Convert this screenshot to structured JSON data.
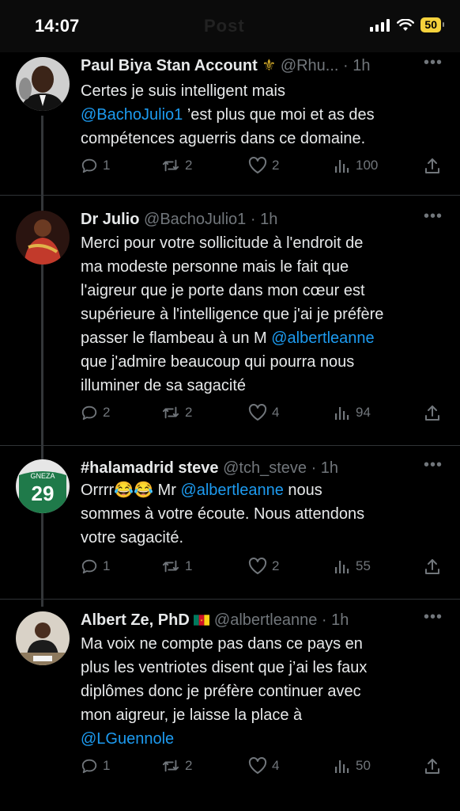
{
  "status": {
    "time": "14:07",
    "ghost_title": "Post",
    "battery": "50"
  },
  "tweets": [
    {
      "name": "Paul Biya Stan Account",
      "badge": "⚜",
      "handle": "@Rhu...",
      "time": "1h",
      "lines": [
        [
          {
            "t": "Certes je suis intelligent mais"
          }
        ],
        [
          {
            "t": "@BachoJulio1",
            "m": true
          },
          {
            "t": " ’est plus que moi et as des"
          }
        ],
        [
          {
            "t": "compétences aguerris dans ce domaine."
          }
        ]
      ],
      "replies": "1",
      "reposts": "2",
      "likes": "2",
      "views": "100"
    },
    {
      "name": "Dr Julio",
      "handle": "@BachoJulio1",
      "time": "1h",
      "lines": [
        [
          {
            "t": "Merci pour votre sollicitude à l'endroit de"
          }
        ],
        [
          {
            "t": "ma modeste personne mais le fait que"
          }
        ],
        [
          {
            "t": "l'aigreur que je porte dans mon cœur est"
          }
        ],
        [
          {
            "t": "supérieure à l'intelligence que j'ai je préfère"
          }
        ],
        [
          {
            "t": "passer le flambeau à un M "
          },
          {
            "t": "@albertleanne",
            "m": true
          }
        ],
        [
          {
            "t": "que j'admire beaucoup qui pourra nous"
          }
        ],
        [
          {
            "t": "illuminer de sa sagacité"
          }
        ]
      ],
      "replies": "2",
      "reposts": "2",
      "likes": "4",
      "views": "94"
    },
    {
      "name": "#halamadrid steve",
      "handle": "@tch_steve",
      "time": "1h",
      "lines": [
        [
          {
            "t": "Orrrr😂😂 Mr "
          },
          {
            "t": "@albertleanne",
            "m": true
          },
          {
            "t": "  nous"
          }
        ],
        [
          {
            "t": "sommes à votre écoute. Nous attendons"
          }
        ],
        [
          {
            "t": "votre sagacité."
          }
        ]
      ],
      "replies": "1",
      "reposts": "1",
      "likes": "2",
      "views": "55"
    },
    {
      "name": "Albert Ze, PhD",
      "handle": "@albertleanne",
      "time": "1h",
      "lines": [
        [
          {
            "t": "Ma voix ne compte pas dans ce pays en"
          }
        ],
        [
          {
            "t": "plus les ventriotes disent que j’ai les faux"
          }
        ],
        [
          {
            "t": "diplômes donc je préfère continuer avec"
          }
        ],
        [
          {
            "t": "mon aigreur, je laisse la place à"
          }
        ],
        [
          {
            "t": "@LGuennole",
            "m": true
          }
        ]
      ],
      "replies": "1",
      "reposts": "2",
      "likes": "4",
      "views": "50"
    }
  ],
  "colors": {
    "background": "#000000",
    "text": "#e7e9ea",
    "secondary": "#71767b",
    "mention": "#1d9bf0",
    "battery": "#f5d23c"
  },
  "icons": [
    "reply-icon",
    "repost-icon",
    "like-icon",
    "views-icon",
    "share-icon",
    "more-icon",
    "cameroon-flag-icon",
    "fleur-de-lis-icon"
  ]
}
